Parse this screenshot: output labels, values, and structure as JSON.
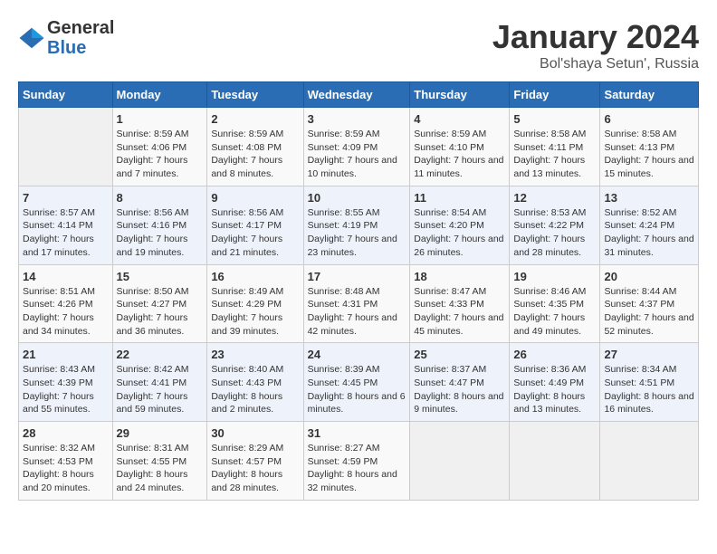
{
  "header": {
    "logo_line1": "General",
    "logo_line2": "Blue",
    "month": "January 2024",
    "location": "Bol'shaya Setun', Russia"
  },
  "days_of_week": [
    "Sunday",
    "Monday",
    "Tuesday",
    "Wednesday",
    "Thursday",
    "Friday",
    "Saturday"
  ],
  "weeks": [
    [
      {
        "day": "",
        "sunrise": "",
        "sunset": "",
        "daylight": ""
      },
      {
        "day": "1",
        "sunrise": "Sunrise: 8:59 AM",
        "sunset": "Sunset: 4:06 PM",
        "daylight": "Daylight: 7 hours and 7 minutes."
      },
      {
        "day": "2",
        "sunrise": "Sunrise: 8:59 AM",
        "sunset": "Sunset: 4:08 PM",
        "daylight": "Daylight: 7 hours and 8 minutes."
      },
      {
        "day": "3",
        "sunrise": "Sunrise: 8:59 AM",
        "sunset": "Sunset: 4:09 PM",
        "daylight": "Daylight: 7 hours and 10 minutes."
      },
      {
        "day": "4",
        "sunrise": "Sunrise: 8:59 AM",
        "sunset": "Sunset: 4:10 PM",
        "daylight": "Daylight: 7 hours and 11 minutes."
      },
      {
        "day": "5",
        "sunrise": "Sunrise: 8:58 AM",
        "sunset": "Sunset: 4:11 PM",
        "daylight": "Daylight: 7 hours and 13 minutes."
      },
      {
        "day": "6",
        "sunrise": "Sunrise: 8:58 AM",
        "sunset": "Sunset: 4:13 PM",
        "daylight": "Daylight: 7 hours and 15 minutes."
      }
    ],
    [
      {
        "day": "7",
        "sunrise": "Sunrise: 8:57 AM",
        "sunset": "Sunset: 4:14 PM",
        "daylight": "Daylight: 7 hours and 17 minutes."
      },
      {
        "day": "8",
        "sunrise": "Sunrise: 8:56 AM",
        "sunset": "Sunset: 4:16 PM",
        "daylight": "Daylight: 7 hours and 19 minutes."
      },
      {
        "day": "9",
        "sunrise": "Sunrise: 8:56 AM",
        "sunset": "Sunset: 4:17 PM",
        "daylight": "Daylight: 7 hours and 21 minutes."
      },
      {
        "day": "10",
        "sunrise": "Sunrise: 8:55 AM",
        "sunset": "Sunset: 4:19 PM",
        "daylight": "Daylight: 7 hours and 23 minutes."
      },
      {
        "day": "11",
        "sunrise": "Sunrise: 8:54 AM",
        "sunset": "Sunset: 4:20 PM",
        "daylight": "Daylight: 7 hours and 26 minutes."
      },
      {
        "day": "12",
        "sunrise": "Sunrise: 8:53 AM",
        "sunset": "Sunset: 4:22 PM",
        "daylight": "Daylight: 7 hours and 28 minutes."
      },
      {
        "day": "13",
        "sunrise": "Sunrise: 8:52 AM",
        "sunset": "Sunset: 4:24 PM",
        "daylight": "Daylight: 7 hours and 31 minutes."
      }
    ],
    [
      {
        "day": "14",
        "sunrise": "Sunrise: 8:51 AM",
        "sunset": "Sunset: 4:26 PM",
        "daylight": "Daylight: 7 hours and 34 minutes."
      },
      {
        "day": "15",
        "sunrise": "Sunrise: 8:50 AM",
        "sunset": "Sunset: 4:27 PM",
        "daylight": "Daylight: 7 hours and 36 minutes."
      },
      {
        "day": "16",
        "sunrise": "Sunrise: 8:49 AM",
        "sunset": "Sunset: 4:29 PM",
        "daylight": "Daylight: 7 hours and 39 minutes."
      },
      {
        "day": "17",
        "sunrise": "Sunrise: 8:48 AM",
        "sunset": "Sunset: 4:31 PM",
        "daylight": "Daylight: 7 hours and 42 minutes."
      },
      {
        "day": "18",
        "sunrise": "Sunrise: 8:47 AM",
        "sunset": "Sunset: 4:33 PM",
        "daylight": "Daylight: 7 hours and 45 minutes."
      },
      {
        "day": "19",
        "sunrise": "Sunrise: 8:46 AM",
        "sunset": "Sunset: 4:35 PM",
        "daylight": "Daylight: 7 hours and 49 minutes."
      },
      {
        "day": "20",
        "sunrise": "Sunrise: 8:44 AM",
        "sunset": "Sunset: 4:37 PM",
        "daylight": "Daylight: 7 hours and 52 minutes."
      }
    ],
    [
      {
        "day": "21",
        "sunrise": "Sunrise: 8:43 AM",
        "sunset": "Sunset: 4:39 PM",
        "daylight": "Daylight: 7 hours and 55 minutes."
      },
      {
        "day": "22",
        "sunrise": "Sunrise: 8:42 AM",
        "sunset": "Sunset: 4:41 PM",
        "daylight": "Daylight: 7 hours and 59 minutes."
      },
      {
        "day": "23",
        "sunrise": "Sunrise: 8:40 AM",
        "sunset": "Sunset: 4:43 PM",
        "daylight": "Daylight: 8 hours and 2 minutes."
      },
      {
        "day": "24",
        "sunrise": "Sunrise: 8:39 AM",
        "sunset": "Sunset: 4:45 PM",
        "daylight": "Daylight: 8 hours and 6 minutes."
      },
      {
        "day": "25",
        "sunrise": "Sunrise: 8:37 AM",
        "sunset": "Sunset: 4:47 PM",
        "daylight": "Daylight: 8 hours and 9 minutes."
      },
      {
        "day": "26",
        "sunrise": "Sunrise: 8:36 AM",
        "sunset": "Sunset: 4:49 PM",
        "daylight": "Daylight: 8 hours and 13 minutes."
      },
      {
        "day": "27",
        "sunrise": "Sunrise: 8:34 AM",
        "sunset": "Sunset: 4:51 PM",
        "daylight": "Daylight: 8 hours and 16 minutes."
      }
    ],
    [
      {
        "day": "28",
        "sunrise": "Sunrise: 8:32 AM",
        "sunset": "Sunset: 4:53 PM",
        "daylight": "Daylight: 8 hours and 20 minutes."
      },
      {
        "day": "29",
        "sunrise": "Sunrise: 8:31 AM",
        "sunset": "Sunset: 4:55 PM",
        "daylight": "Daylight: 8 hours and 24 minutes."
      },
      {
        "day": "30",
        "sunrise": "Sunrise: 8:29 AM",
        "sunset": "Sunset: 4:57 PM",
        "daylight": "Daylight: 8 hours and 28 minutes."
      },
      {
        "day": "31",
        "sunrise": "Sunrise: 8:27 AM",
        "sunset": "Sunset: 4:59 PM",
        "daylight": "Daylight: 8 hours and 32 minutes."
      },
      {
        "day": "",
        "sunrise": "",
        "sunset": "",
        "daylight": ""
      },
      {
        "day": "",
        "sunrise": "",
        "sunset": "",
        "daylight": ""
      },
      {
        "day": "",
        "sunrise": "",
        "sunset": "",
        "daylight": ""
      }
    ]
  ]
}
